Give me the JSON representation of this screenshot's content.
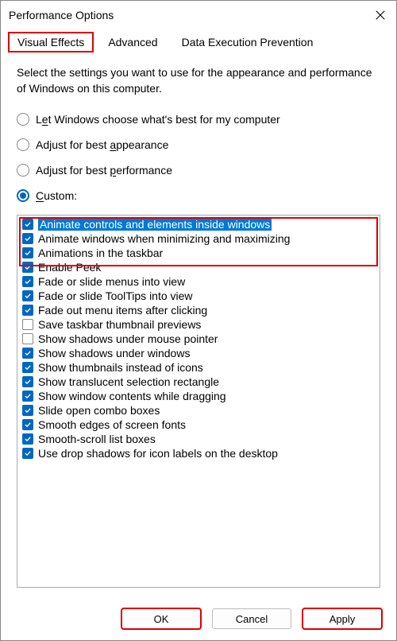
{
  "window": {
    "title": "Performance Options"
  },
  "tabs": {
    "visual_effects": "Visual Effects",
    "advanced": "Advanced",
    "dep": "Data Execution Prevention"
  },
  "description": "Select the settings you want to use for the appearance and performance of Windows on this computer.",
  "radios": {
    "let_pre": "L",
    "let_u": "e",
    "let_post": "t Windows choose what's best for my computer",
    "best_app_pre": "Adjust for best ",
    "best_app_u": "a",
    "best_app_post": "ppearance",
    "best_perf_pre": "Adjust for best ",
    "best_perf_u": "p",
    "best_perf_post": "erformance",
    "custom_pre": "",
    "custom_u": "C",
    "custom_post": "ustom:"
  },
  "checks": [
    {
      "label": "Animate controls and elements inside windows",
      "checked": true,
      "selected": true
    },
    {
      "label": "Animate windows when minimizing and maximizing",
      "checked": true,
      "selected": false
    },
    {
      "label": "Animations in the taskbar",
      "checked": true,
      "selected": false
    },
    {
      "label": "Enable Peek",
      "checked": true,
      "selected": false
    },
    {
      "label": "Fade or slide menus into view",
      "checked": true,
      "selected": false
    },
    {
      "label": "Fade or slide ToolTips into view",
      "checked": true,
      "selected": false
    },
    {
      "label": "Fade out menu items after clicking",
      "checked": true,
      "selected": false
    },
    {
      "label": "Save taskbar thumbnail previews",
      "checked": false,
      "selected": false
    },
    {
      "label": "Show shadows under mouse pointer",
      "checked": false,
      "selected": false
    },
    {
      "label": "Show shadows under windows",
      "checked": true,
      "selected": false
    },
    {
      "label": "Show thumbnails instead of icons",
      "checked": true,
      "selected": false
    },
    {
      "label": "Show translucent selection rectangle",
      "checked": true,
      "selected": false
    },
    {
      "label": "Show window contents while dragging",
      "checked": true,
      "selected": false
    },
    {
      "label": "Slide open combo boxes",
      "checked": true,
      "selected": false
    },
    {
      "label": "Smooth edges of screen fonts",
      "checked": true,
      "selected": false
    },
    {
      "label": "Smooth-scroll list boxes",
      "checked": true,
      "selected": false
    },
    {
      "label": "Use drop shadows for icon labels on the desktop",
      "checked": true,
      "selected": false
    }
  ],
  "buttons": {
    "ok": "OK",
    "cancel": "Cancel",
    "apply": "Apply"
  }
}
